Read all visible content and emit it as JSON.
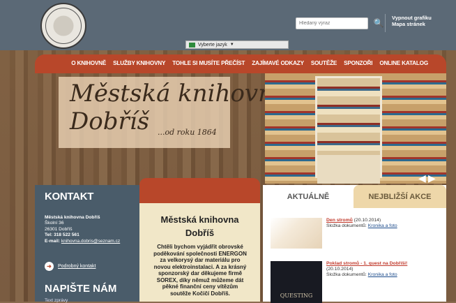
{
  "header": {
    "search_placeholder": "Hledaný výraz",
    "links": [
      "Vypnout grafiku",
      "Mapa stránek"
    ],
    "language_select": "Vyberte jazyk"
  },
  "nav": {
    "items": [
      "O KNIHOVNĚ",
      "SLUŽBY KNIHOVNY",
      "TOHLE SI MUSÍTE PŘEČÍST",
      "ZAJÍMAVÉ ODKAZY",
      "SOUTĚŽE",
      "SPONZOŘI",
      "ONLINE KATALOG"
    ]
  },
  "banner": {
    "title_line1": "Městská knihovna",
    "title_line2": "Dobříš",
    "subtitle": "...od roku 1864"
  },
  "contact": {
    "heading": "KONTAKT",
    "name": "Městská knihovna Dobříš",
    "street": "Školní 36",
    "city": "26301 Dobříš",
    "phone": "Tel: 318 522 561",
    "email_label": "E-mail:",
    "email": "knihovna.dobris@seznam.cz",
    "detail_link": "Podrobný kontakt",
    "write_heading": "NAPIŠTE NÁM",
    "message_label": "Text zprávy"
  },
  "center": {
    "title_line1": "Městská knihovna",
    "title_line2": "Dobříš",
    "body": "Chtěli bychom vyjádřit obrovské poděkování společnosti ENERGON za velkorysý dar materiálu pro novou elektroinstalaci. A za krásný sponzorský dar děkujeme firmě SOREX, díky němuž můžeme dát pěkné finanční ceny vítězům soutěže Kočičí Dobříš."
  },
  "news": {
    "tab_active": "AKTUÁLNĚ",
    "tab_other": "NEJBLIŽŠÍ AKCE",
    "items": [
      {
        "title": "Den stromů",
        "date": "(20.10.2014)",
        "folder_label": "Složka dokumentů:",
        "folder": "Kronika a foto"
      },
      {
        "title": "Poklad stromů - 1. quest na Dobříši!",
        "date": "(20.10.2014)",
        "folder_label": "Složka dokumentů:",
        "folder": "Kronika a foto",
        "thumb_text": "QUESTING"
      }
    ]
  }
}
